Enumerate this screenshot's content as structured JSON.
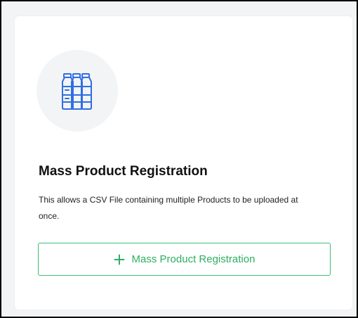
{
  "card": {
    "icon": "bottles-icon",
    "title": "Mass Product Registration",
    "description": "This allows a CSV File containing multiple Products to be uploaded at once.",
    "button_label": "Mass Product Registration",
    "button_icon": "plus-icon"
  },
  "colors": {
    "accent": "#2fae62",
    "icon": "#2f6fe4",
    "circle_bg": "#f3f4f6",
    "page_bg": "#f3f4f6"
  }
}
